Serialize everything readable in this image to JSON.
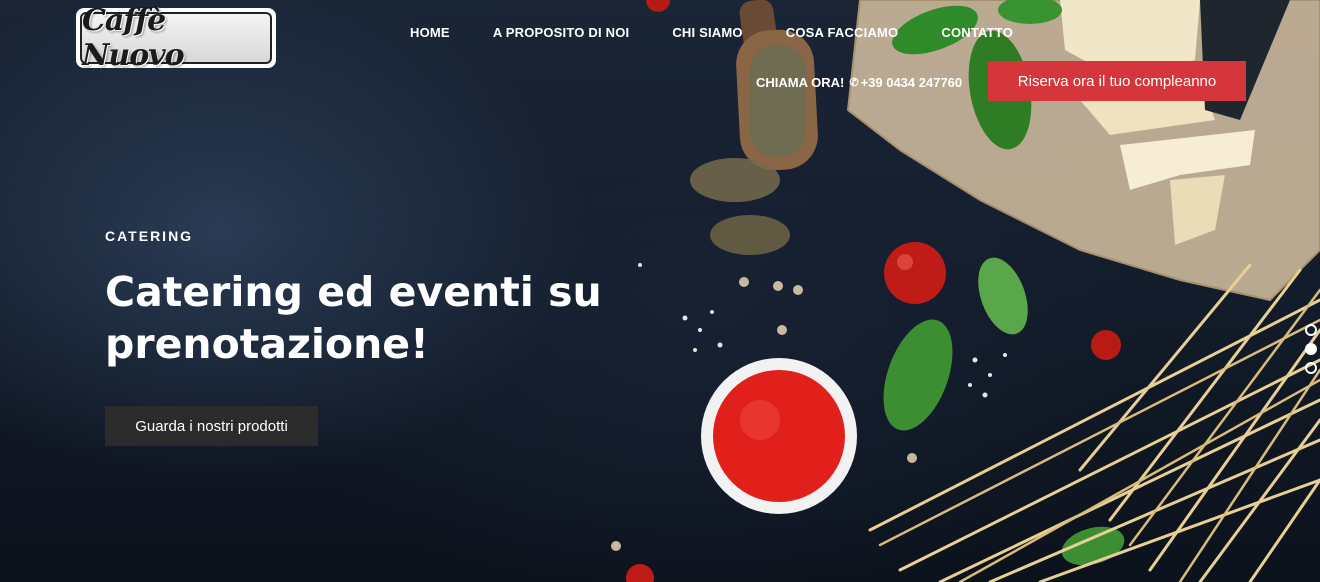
{
  "brand": {
    "logo_text": "Caffè Nuovo"
  },
  "nav": {
    "items": [
      {
        "label": "HOME"
      },
      {
        "label": "A PROPOSITO DI NOI"
      },
      {
        "label": "CHI SIAMO"
      },
      {
        "label": "COSA FACCIAMO"
      },
      {
        "label": "CONTATTO"
      }
    ]
  },
  "contact": {
    "call_label": "CHIAMA ORA!",
    "phone_icon": "phone-icon",
    "phone": "+39 0434 247760"
  },
  "cta": {
    "book_label": "Riserva ora il tuo compleanno",
    "products_label": "Guarda i nostri prodotti"
  },
  "hero": {
    "eyebrow": "CATERING",
    "headline": "Catering ed eventi su prenotazione!"
  },
  "slider": {
    "slide_count": 3,
    "active_index": 1
  },
  "colors": {
    "accent_red": "#d4363b",
    "dark_button": "#2b2b2b",
    "background": "#121b29"
  }
}
